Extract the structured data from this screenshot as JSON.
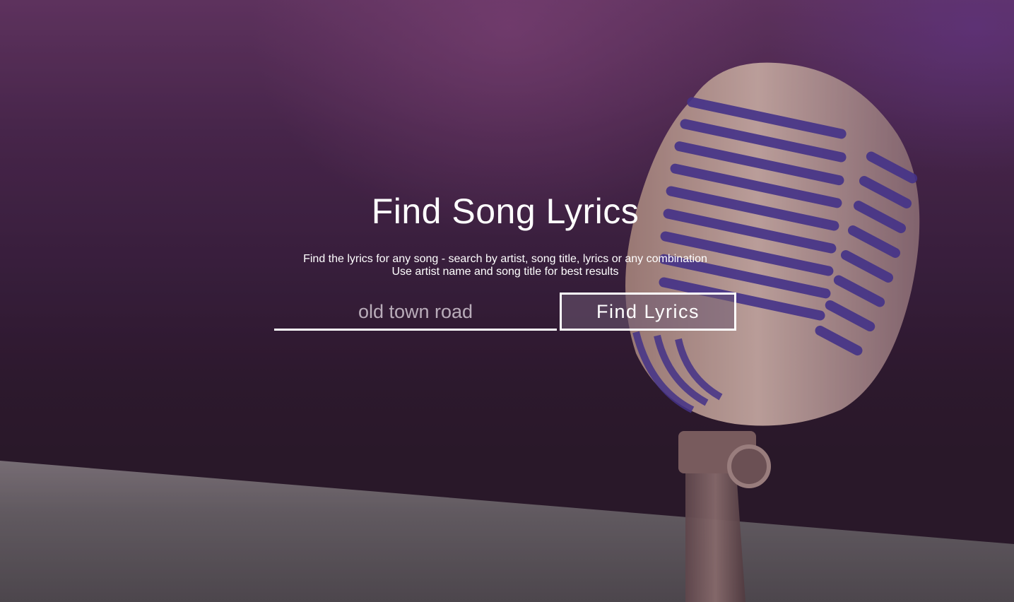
{
  "hero": {
    "title": "Find Song Lyrics",
    "subtitle_line1": "Find the lyrics for any song - search by artist, song title, lyrics or any combination",
    "subtitle_line2": "Use artist name and song title for best results"
  },
  "search": {
    "placeholder": "old town road",
    "value": "",
    "button_label": "Find Lyrics"
  },
  "colors": {
    "text": "#ffffff",
    "background_top": "#6a3a6a",
    "background_mid": "#3b2140",
    "accent_purple": "#5b3a9a"
  }
}
